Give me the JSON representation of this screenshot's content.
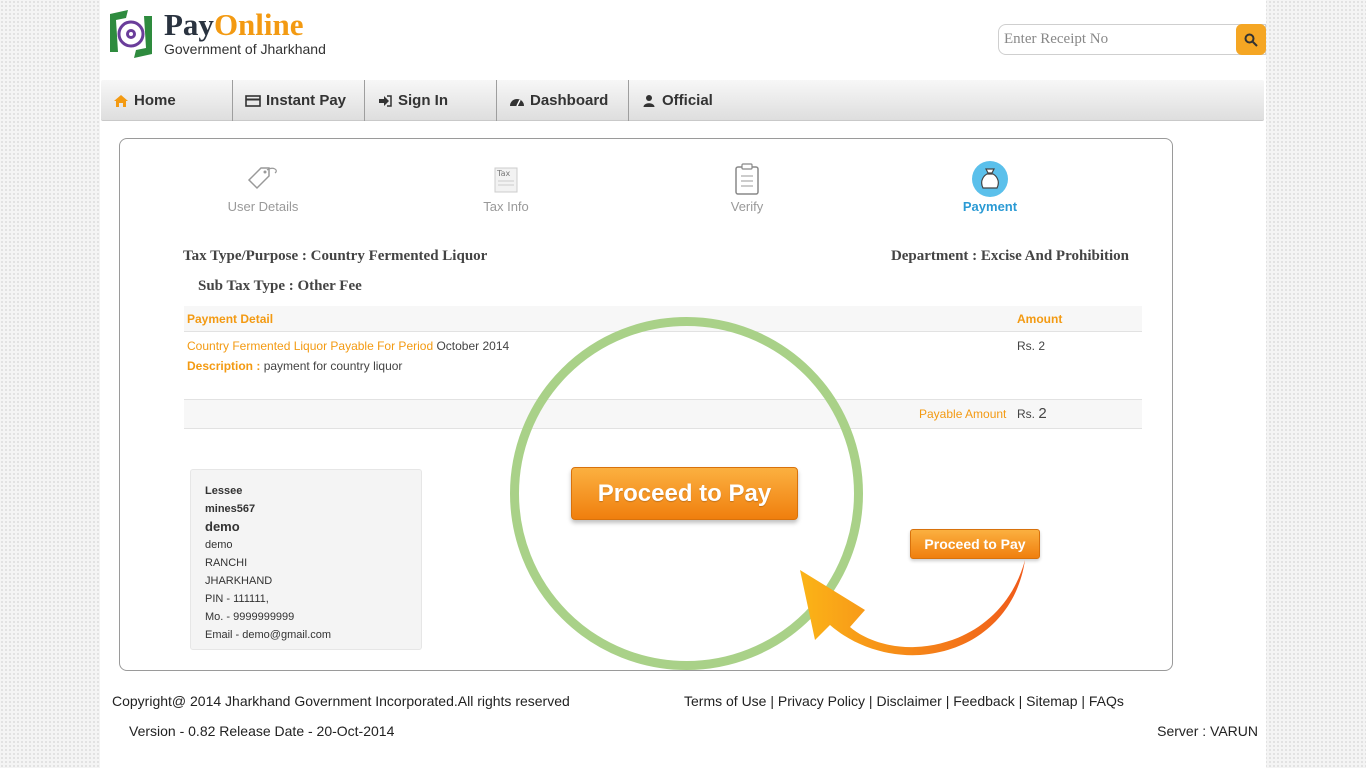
{
  "brand": {
    "title_part1": "Pay",
    "title_part2": "Online",
    "subtitle": "Government of Jharkhand"
  },
  "search": {
    "placeholder": "Enter Receipt No",
    "icon": "search-icon"
  },
  "nav": {
    "items": [
      {
        "label": "Home",
        "icon": "home-icon"
      },
      {
        "label": "Instant Pay",
        "icon": "credit-card-icon"
      },
      {
        "label": "Sign In",
        "icon": "sign-in-icon"
      },
      {
        "label": "Dashboard",
        "icon": "dashboard-icon"
      },
      {
        "label": "Official",
        "icon": "user-icon"
      }
    ]
  },
  "steps": [
    {
      "label": "User Details",
      "icon": "tag-icon"
    },
    {
      "label": "Tax Info",
      "icon": "tax-icon"
    },
    {
      "label": "Verify",
      "icon": "clipboard-icon"
    },
    {
      "label": "Payment",
      "icon": "money-bag-icon",
      "active": true
    }
  ],
  "info": {
    "tax_type": "Tax Type/Purpose : Country Fermented Liquor",
    "department": "Department : Excise And Prohibition",
    "sub_tax_type": "Sub Tax Type : Other Fee"
  },
  "table": {
    "col_detail": "Payment Detail",
    "col_amount": "Amount",
    "row": {
      "item": "Country Fermented Liquor Payable For Period",
      "period": "October 2014",
      "desc_label": "Description :",
      "desc_value": "payment for country liquor",
      "amount": "Rs. 2"
    },
    "payable_label": "Payable Amount",
    "payable_currency": "Rs.",
    "payable_value": "2"
  },
  "address": {
    "title": "Lessee",
    "username": "mines567",
    "name": "demo",
    "line1": "demo",
    "city": "RANCHI",
    "state": "JHARKHAND",
    "pin": "PIN - 111111,",
    "mobile": "Mo. - 9999999999",
    "email": "Email - demo@gmail.com"
  },
  "actions": {
    "proceed_big": "Proceed to Pay",
    "proceed_small": "Proceed to Pay"
  },
  "footer": {
    "copyright": "Copyright@ 2014 Jharkhand Government Incorporated.All rights reserved",
    "links": [
      "Terms of Use",
      "Privacy Policy",
      "Disclaimer",
      "Feedback",
      "Sitemap",
      "FAQs"
    ],
    "separator": "|",
    "version": "Version - 0.82 Release Date - 20-Oct-2014",
    "server": "Server : VARUN"
  },
  "colors": {
    "accent_orange": "#f39a12",
    "active_blue": "#2a9ad4",
    "highlight_green": "#a9d188",
    "arrow_orange": "#f07f0e"
  }
}
